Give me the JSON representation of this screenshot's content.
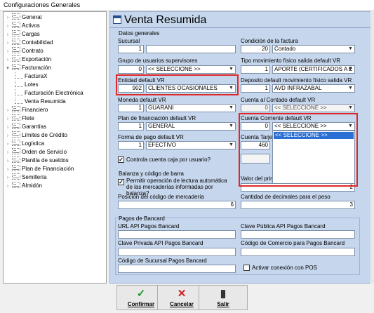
{
  "window": {
    "title": "Configuraciones Generales"
  },
  "tree": {
    "items": [
      {
        "label": "General",
        "level": 0,
        "expandable": true
      },
      {
        "label": "Activos",
        "level": 0,
        "expandable": true
      },
      {
        "label": "Cargas",
        "level": 0,
        "expandable": true
      },
      {
        "label": "Contabilidad",
        "level": 0,
        "expandable": true
      },
      {
        "label": "Contrato",
        "level": 0,
        "expandable": true
      },
      {
        "label": "Exportación",
        "level": 0,
        "expandable": true
      },
      {
        "label": "Facturación",
        "level": 0,
        "expandable": true,
        "expanded": true
      },
      {
        "label": "FacturaX",
        "level": 1
      },
      {
        "label": "Lotes",
        "level": 1
      },
      {
        "label": "Facturación Electrónica",
        "level": 1
      },
      {
        "label": "Venta Resumida",
        "level": 1
      },
      {
        "label": "Financiero",
        "level": 0,
        "expandable": true
      },
      {
        "label": "Flete",
        "level": 0,
        "expandable": true
      },
      {
        "label": "Garantías",
        "level": 0,
        "expandable": true
      },
      {
        "label": "Límites de Crédito",
        "level": 0,
        "expandable": true
      },
      {
        "label": "Logística",
        "level": 0,
        "expandable": true
      },
      {
        "label": "Orden de Servicio",
        "level": 0,
        "expandable": true
      },
      {
        "label": "Planilla de sueldos",
        "level": 0,
        "expandable": true
      },
      {
        "label": "Plan de Financiación",
        "level": 0,
        "expandable": true
      },
      {
        "label": "Semillería",
        "level": 0,
        "expandable": true
      },
      {
        "label": "Almidón",
        "level": 0,
        "expandable": true
      }
    ]
  },
  "main": {
    "title": "Venta Resumida",
    "datos_generales": "Datos generales",
    "sucursal": {
      "label": "Sucursal",
      "code": "1",
      "name": ""
    },
    "grupo_usuarios": {
      "label": "Grupo de usuarios supervisores",
      "code": "0",
      "value": "<< SELECCIONE >>"
    },
    "entidad": {
      "label": "Entidad default VR",
      "code": "902",
      "value": "CLIENTES OCASIONALES"
    },
    "moneda": {
      "label": "Moneda default VR",
      "code": "1",
      "value": "GUARANI"
    },
    "plan_fin": {
      "label": "Plan de financiación default VR",
      "code": "1",
      "value": "GENERAL"
    },
    "forma_pago": {
      "label": "Forma de pago default VR",
      "code": "1",
      "value": "EFECTIVO"
    },
    "controla_caja": {
      "label": "Controla cuenta caja por usuario?",
      "checked": true
    },
    "condicion": {
      "label": "Condición de la factura",
      "code": "20",
      "value": "Contado"
    },
    "tipo_mov": {
      "label": "Tipo movimiento físico salida default VR",
      "code": "1",
      "value": "APORTE (CERTIFICADOS A E"
    },
    "deposito": {
      "label": "Deposito default movimiento físico salida VR",
      "code": "1",
      "value": "AVD INFRAZABAL"
    },
    "cuenta_contado": {
      "label": "Cuenta al Contado default VR",
      "code": "0",
      "value": "<< SELECCIONE >>"
    },
    "cuenta_corriente": {
      "label": "Cuenta Corriente default VR",
      "code": "0",
      "value": "<< SELECCIONE >>"
    },
    "dropdown_options": [
      "<< SELECCIONE >>"
    ],
    "cuenta_tarjeta": {
      "label": "Cuenta Tarje",
      "code": "460"
    },
    "valor_primer": {
      "label": "Valor del prim",
      "value": "2"
    },
    "balanza": {
      "label": "Balanza y código de barra",
      "permitir": "Permitir operación de lectura automática de las mercaderías informadas por balanza?",
      "permitir_checked": true,
      "posicion_label": "Posición del código de mercadería",
      "posicion_value": "6",
      "decimales_label": "Cantidad de decimales para el peso",
      "decimales_value": "3"
    },
    "pagos": {
      "label": "Pagos de Bancard",
      "url_label": "URL API Pagos Bancard",
      "clave_publica_label": "Clave Pública API Pagos Bancard",
      "clave_privada_label": "Clave Privada API Pagos Bancard",
      "codigo_comercio_label": "Código de Comercio para Pagos Bancard",
      "codigo_sucursal_label": "Código de Sucursal Pagos Bancard",
      "activar_pos_label": "Activar conexión con POS"
    }
  },
  "buttons": {
    "confirmar": "Confirmar",
    "cancelar": "Cancelar",
    "salir": "Salir"
  },
  "colors": {
    "accent": "#2a6fd4",
    "highlight_box": "#e02828",
    "panel": "#c6d6ec"
  }
}
